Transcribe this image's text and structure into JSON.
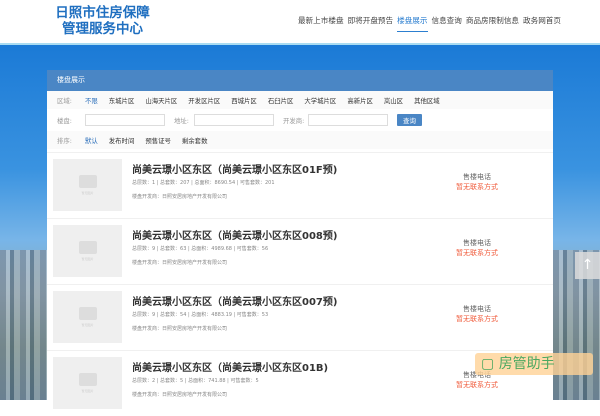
{
  "header": {
    "logo_line1": "日照市住房保障",
    "logo_line2": "管理服务中心",
    "nav": [
      "最新上市楼盘",
      "即将开盘预告",
      "楼盘展示",
      "信息查询",
      "商品房限制信息",
      "政务网首页"
    ],
    "active_nav": 2
  },
  "panel": {
    "title": "楼盘展示",
    "region_label": "区域:",
    "regions": [
      "不限",
      "东城片区",
      "山海天片区",
      "开发区片区",
      "西城片区",
      "石臼片区",
      "大学城片区",
      "高新片区",
      "岚山区",
      "其他区域"
    ],
    "search": {
      "building_label": "楼盘:",
      "address_label": "地址:",
      "developer_label": "开发商:",
      "button": "查询",
      "building_value": "",
      "address_value": "",
      "developer_value": ""
    },
    "sort_label": "排序:",
    "sorts": [
      "默认",
      "发布时间",
      "预售证号",
      "剩余套数"
    ]
  },
  "listings": [
    {
      "title": "尚美云璟小区东区（尚美云璟小区东区01F预)",
      "stats": "总层数：1 | 总套数：207 | 总面积：8690.54 | 可售套数：201",
      "developer": "楼盘开发商：日照安居房地产开发有限公司",
      "tel_label": "售楼电话",
      "tel": "暂无联系方式",
      "placeholder": "暂无图片"
    },
    {
      "title": "尚美云璟小区东区（尚美云璟小区东区008预)",
      "stats": "总层数：9 | 总套数：63 | 总面积：4989.68 | 可售套数：56",
      "developer": "楼盘开发商：日照安居房地产开发有限公司",
      "tel_label": "售楼电话",
      "tel": "暂无联系方式",
      "placeholder": "暂无图片"
    },
    {
      "title": "尚美云璟小区东区（尚美云璟小区东区007预)",
      "stats": "总层数：9 | 总套数：54 | 总面积：4883.19 | 可售套数：53",
      "developer": "楼盘开发商：日照安居房地产开发有限公司",
      "tel_label": "售楼电话",
      "tel": "暂无联系方式",
      "placeholder": "暂无图片"
    },
    {
      "title": "尚美云璟小区东区（尚美云璟小区东区01B)",
      "stats": "总层数：2 | 总套数：5 | 总面积：741.88 | 可售套数：5",
      "developer": "楼盘开发商：日照安居房地产开发有限公司",
      "tel_label": "售楼电话",
      "tel": "暂无联系方式",
      "placeholder": "暂无图片"
    }
  ],
  "back_to_top": "↑",
  "watermark": "房管助手"
}
